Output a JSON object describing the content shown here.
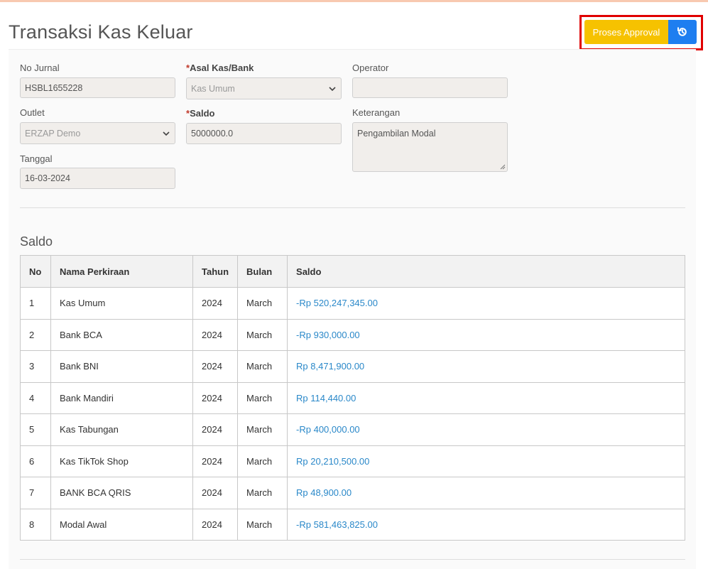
{
  "page": {
    "title": "Transaksi Kas Keluar"
  },
  "actions": {
    "approval_label": "Proses Approval",
    "reset_icon": "history-icon"
  },
  "form": {
    "no_jurnal": {
      "label": "No Jurnal",
      "value": "HSBL1655228"
    },
    "outlet": {
      "label": "Outlet",
      "value": "ERZAP Demo"
    },
    "tanggal": {
      "label": "Tanggal",
      "value": "16-03-2024"
    },
    "asal_kas": {
      "required_mark": "*",
      "label": "Asal Kas/Bank",
      "value": "Kas Umum"
    },
    "saldo": {
      "required_mark": "*",
      "label": "Saldo",
      "value": "5000000.0"
    },
    "operator": {
      "label": "Operator",
      "value": ""
    },
    "keterangan": {
      "label": "Keterangan",
      "value": "Pengambilan Modal"
    }
  },
  "saldo_section": {
    "title": "Saldo",
    "headers": {
      "no": "No",
      "nama": "Nama Perkiraan",
      "tahun": "Tahun",
      "bulan": "Bulan",
      "saldo": "Saldo"
    },
    "rows": [
      {
        "no": "1",
        "nama": "Kas Umum",
        "tahun": "2024",
        "bulan": "March",
        "saldo": "-Rp 520,247,345.00"
      },
      {
        "no": "2",
        "nama": "Bank BCA",
        "tahun": "2024",
        "bulan": "March",
        "saldo": "-Rp 930,000.00"
      },
      {
        "no": "3",
        "nama": "Bank BNI",
        "tahun": "2024",
        "bulan": "March",
        "saldo": "Rp 8,471,900.00"
      },
      {
        "no": "4",
        "nama": "Bank Mandiri",
        "tahun": "2024",
        "bulan": "March",
        "saldo": "Rp 114,440.00"
      },
      {
        "no": "5",
        "nama": "Kas Tabungan",
        "tahun": "2024",
        "bulan": "March",
        "saldo": "-Rp 400,000.00"
      },
      {
        "no": "6",
        "nama": "Kas TikTok Shop",
        "tahun": "2024",
        "bulan": "March",
        "saldo": "Rp 20,210,500.00"
      },
      {
        "no": "7",
        "nama": "BANK BCA QRIS",
        "tahun": "2024",
        "bulan": "March",
        "saldo": "Rp 48,900.00"
      },
      {
        "no": "8",
        "nama": "Modal Awal",
        "tahun": "2024",
        "bulan": "March",
        "saldo": "-Rp 581,463,825.00"
      }
    ]
  },
  "colors": {
    "approval": "#f6c200",
    "reset": "#1e7ef0",
    "highlight": "#e00000",
    "amount": "#2a88c9"
  }
}
